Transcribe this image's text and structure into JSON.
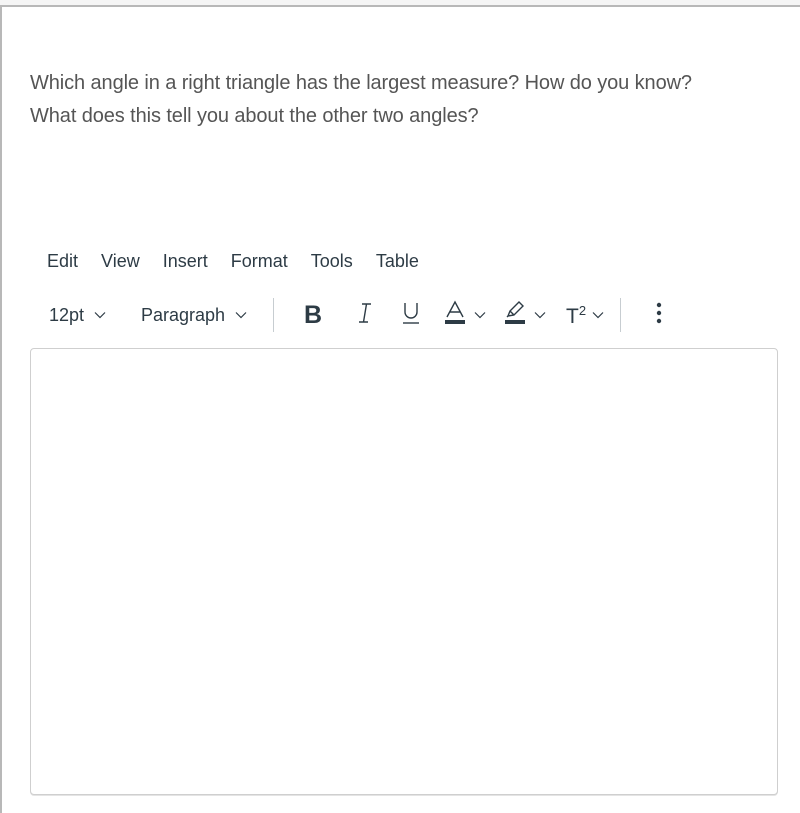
{
  "question": {
    "line1": "Which angle in a right triangle has the largest measure? How do you know?",
    "line2": "What does this tell you about the other two angles?"
  },
  "menubar": {
    "items": [
      "Edit",
      "View",
      "Insert",
      "Format",
      "Tools",
      "Table"
    ]
  },
  "toolbar": {
    "font_size": "12pt",
    "block_format": "Paragraph",
    "bold_label": "B",
    "italic_label": "I",
    "underline_label": "U",
    "text_color_label": "A",
    "superscript_label": "T",
    "superscript_sup": "2",
    "more_label": "⋮"
  },
  "colors": {
    "text_color_swatch": "#2d3b45",
    "highlight_swatch": "#2d3b45",
    "icon": "#2d3b45"
  },
  "editor": {
    "content": ""
  }
}
